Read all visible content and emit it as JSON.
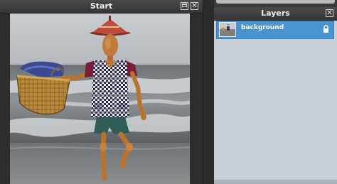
{
  "start_window": {
    "title": "Start",
    "maximize_icon": "maximize-icon",
    "close_icon": "close-icon",
    "close_glyph": "✕"
  },
  "layers_window": {
    "title": "Layers",
    "close_glyph": "✕",
    "layers": [
      {
        "name": "background",
        "selected": true,
        "locked": true
      }
    ]
  },
  "colors": {
    "titlebar": "#3d3d3d",
    "layer_selected": "#4a93d1",
    "layers_bg": "#c8d0d6"
  }
}
